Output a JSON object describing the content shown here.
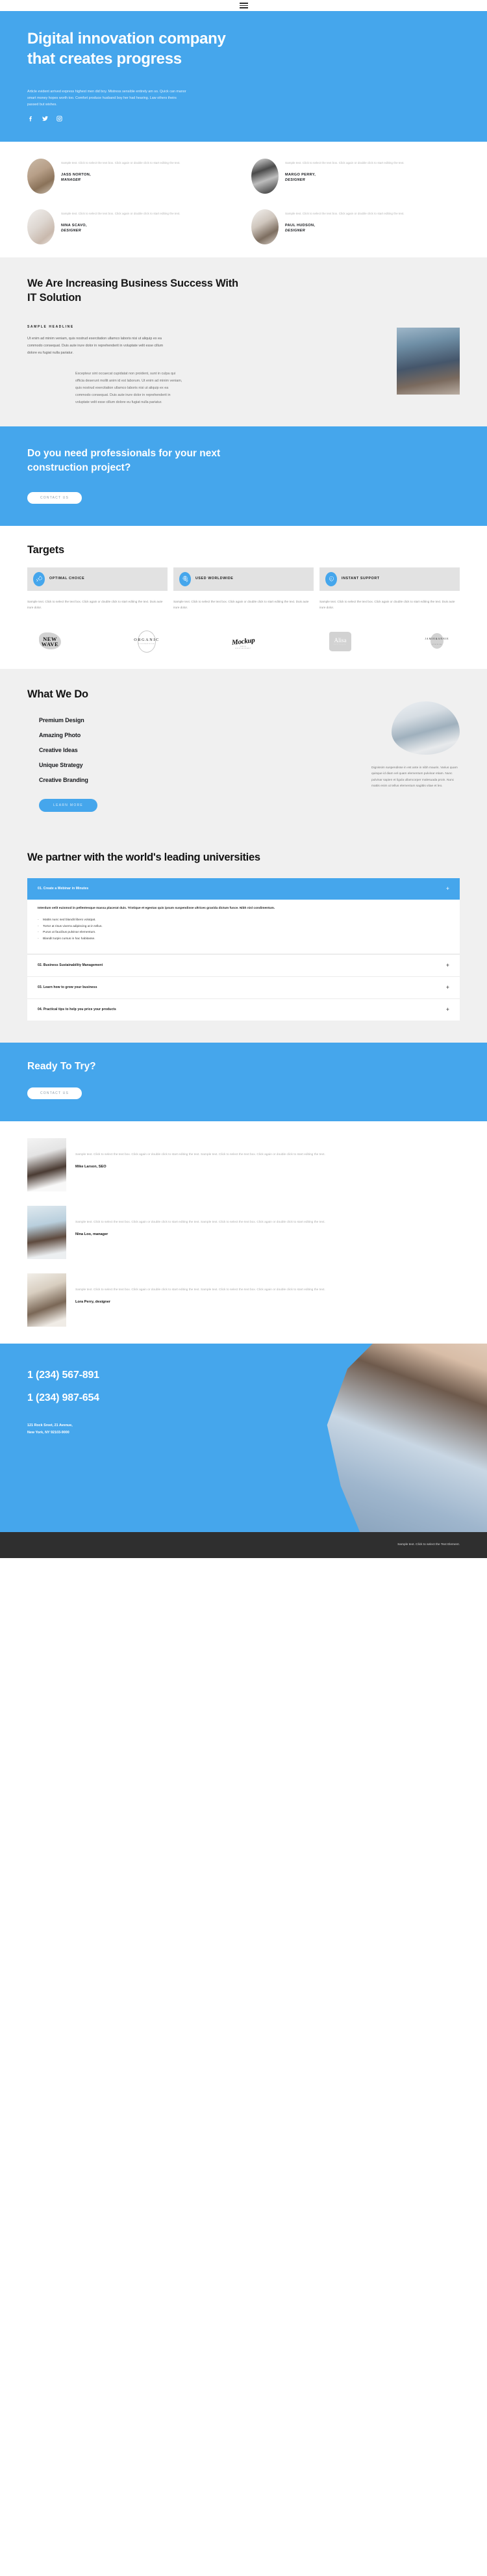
{
  "topbar": {
    "menu_icon": "hamburger-menu-icon"
  },
  "hero": {
    "title": "Digital innovation company that creates progress",
    "description": "Article evident arrived express highest men did boy. Mistress sensible entirely am so. Quick can manor smart money hopes worth too. Comfort produce husband boy her had hearing. Law others theirs passed but wishes.",
    "socials": [
      "facebook-icon",
      "twitter-icon",
      "instagram-icon"
    ],
    "bg_color": "#45a6ec"
  },
  "testimonials": {
    "quote": "Sample text. Click to select the text box. Click again or double click to start editing the text.",
    "items": [
      {
        "name": "JASS NORTON,",
        "role": "MANAGER",
        "avatar": "av1"
      },
      {
        "name": "MARGO PERRY,",
        "role": "DESIGNER",
        "avatar": "av2"
      },
      {
        "name": "NINA SCAVO,",
        "role": "DESIGNER",
        "avatar": "av3"
      },
      {
        "name": "PAUL HUDSON,",
        "role": "DESIGNER",
        "avatar": "av4"
      }
    ]
  },
  "increase": {
    "title": "We Are Increasing Business Success With IT Solution",
    "kicker": "SAMPLE HEADLINE",
    "lead": "Ut enim ad minim veniam, quis nostrud exercitation ullamco laboris nisi ut aliquip ex ea commodo consequat. Duis aute irure dolor in reprehenderit in voluptate velit esse cillum dolore eu fugiat nulla pariatur.",
    "indent": "Excepteur sint occaecat cupidatat non proident, sunt in culpa qui officia deserunt mollit anim id est laborum. Ut enim ad minim veniam, quis nostrud exercitation ullamco laboris nisi ut aliquip ex ea commodo consequat. Duis aute irure dolor in reprehenderit in voluptate velit esse cillum dolore eu fugiat nulla pariatur."
  },
  "cta_construction": {
    "title": "Do you need professionals for your next construction project?",
    "button": "CONTACT US"
  },
  "targets": {
    "title": "Targets",
    "cards": [
      {
        "label": "OPTIMAL CHOICE",
        "icon": "rocket-icon",
        "desc": "Sample text. Click to select the text box. Click again or double click to start editing the text. Duis aute irure dolor."
      },
      {
        "label": "USED WORLDWIDE",
        "icon": "globe-pin-icon",
        "desc": "Sample text. Click to select the text box. Click again or double click to start editing the text. Duis aute irure dolor."
      },
      {
        "label": "INSTANT SUPPORT",
        "icon": "heart-handshake-icon",
        "desc": "Sample text. Click to select the text box. Click again or double click to start editing the text. Duis aute irure dolor."
      }
    ]
  },
  "logos": [
    {
      "name": "NEW WAVE",
      "line1": "NEW",
      "line2": "WAVE",
      "sub": ""
    },
    {
      "name": "ORGANIC",
      "line1": "ORGANIC",
      "line2": "",
      "sub": "FOOD&DRINK"
    },
    {
      "name": "Mockup",
      "line1": "Mockup",
      "line2": "",
      "sub": "BAKE RESTAURANT"
    },
    {
      "name": "Alisa",
      "line1": "Alisa",
      "line2": "",
      "sub": "BOUTIQUE"
    },
    {
      "name": "JAMIE&ANNIE",
      "line1": "JAMIE&ANNIE",
      "line2": "",
      "sub": "STUDIO"
    }
  ],
  "whatwedo": {
    "title": "What We Do",
    "items": [
      "Premium Design",
      "Amazing Photo",
      "Creative Ideas",
      "Unique Strategy",
      "Creative Branding"
    ],
    "button": "LEARN MORE",
    "side_text": "Dignissim suspendisse in est ante in nibh mauris. Varius quam quisque id diam vel quam elementum pulvinar etiam. Nunc pulvinar sapien et ligula ullamcorper malesuada proin. Nunc mattis enim ut tellus elementum sagittis vitae et leo."
  },
  "partner": {
    "title": "We partner with the world's leading universities",
    "accordion": [
      {
        "title": "01. Create a Webinar in Minutes",
        "open": true,
        "lead": "Interdum velit euismod in pellentesque massa placerat duis. Tristique et egestas quis ipsum suspendisse ultrices gravida dictum fusce. Nibh nisl condimentum.",
        "bullets": [
          "Mattis nunc sed blandit libero volutpat.",
          "Tortor at risus viverra adipiscing at in tellus.",
          "Purus ut faucibus pulvinar elementum.",
          "Blandit turpis cursus in hac habitasse."
        ]
      },
      {
        "title": "02. Business Sustainability Management",
        "open": false
      },
      {
        "title": "03. Learn how to grow your business",
        "open": false
      },
      {
        "title": "04. Practical tips to help you price your products",
        "open": false
      }
    ],
    "plus_icon": "plus-icon"
  },
  "ready": {
    "title": "Ready To Try?",
    "button": "CONTACT US"
  },
  "reviews": {
    "quote": "Sample text. Click to select the text box. Click again or double click to start editing the text. Sample text. Click to select the text box. Click again or double click to start editing the text.",
    "items": [
      {
        "name": "Mike Larson, SEO",
        "photo": "rp1"
      },
      {
        "name": "Nina Loo, manager",
        "photo": "rp2"
      },
      {
        "name": "Lora Perry, designer",
        "photo": "rp3"
      }
    ]
  },
  "footer": {
    "phone1": "1 (234) 567-891",
    "phone2": "1 (234) 987-654",
    "address_line1": "121 Rock Sreet, 21 Avenue,",
    "address_line2": "New York, NY 92103-9000",
    "bottom_text": "Sample text. Click to select the Text Element."
  }
}
